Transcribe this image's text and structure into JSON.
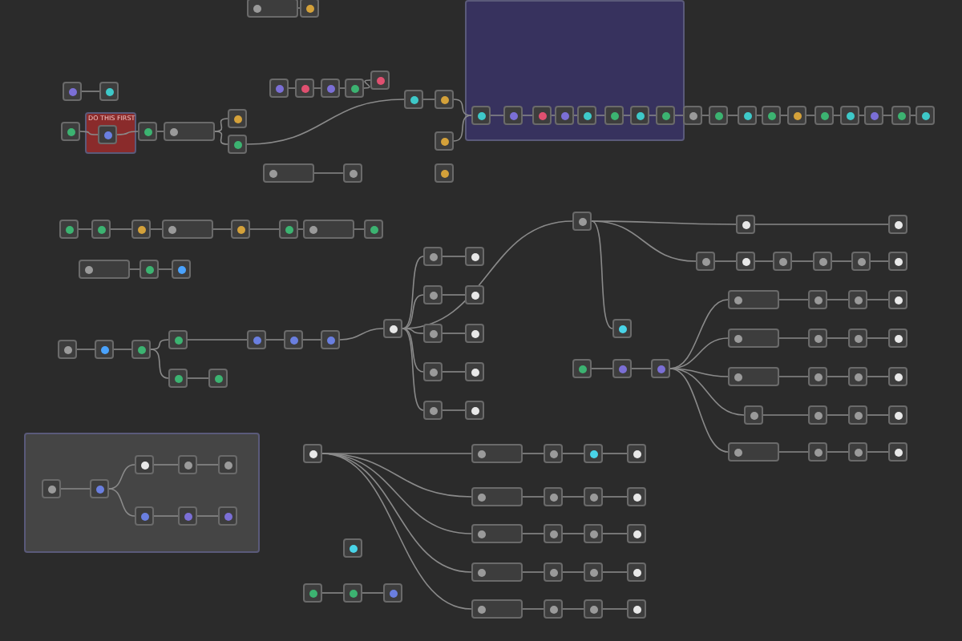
{
  "canvas": {
    "sticky_notes": [
      {
        "color": "#37325e"
      },
      {
        "color": "#8a2b2b",
        "title": "DO THIS FIRST"
      },
      {
        "color": "#454545"
      }
    ],
    "nodes": [
      {
        "kind": "wide",
        "color": "#9a9a9a"
      },
      {
        "kind": "square",
        "color": "#d4a13a"
      },
      {
        "kind": "square",
        "color": "#7b6fd6"
      },
      {
        "kind": "square",
        "color": "#e05070"
      },
      {
        "kind": "square",
        "color": "#7b6fd6"
      },
      {
        "kind": "square",
        "color": "#3cb371"
      },
      {
        "kind": "square",
        "color": "#e05070"
      },
      {
        "kind": "square",
        "color": "#3ec9c9"
      },
      {
        "kind": "square",
        "color": "#d4a13a"
      },
      {
        "kind": "square",
        "color": "#d4a13a"
      },
      {
        "kind": "square",
        "color": "#3ec9c9"
      },
      {
        "kind": "square",
        "color": "#7b6fd6"
      },
      {
        "kind": "square",
        "color": "#e05070"
      },
      {
        "kind": "square",
        "color": "#7b6fd6"
      },
      {
        "kind": "square",
        "color": "#3ec9c9"
      },
      {
        "kind": "square",
        "color": "#3cb371"
      },
      {
        "kind": "square",
        "color": "#3ec9c9"
      },
      {
        "kind": "square",
        "color": "#3cb371"
      },
      {
        "kind": "square",
        "color": "#9a9a9a"
      },
      {
        "kind": "square",
        "color": "#3cb371"
      },
      {
        "kind": "square",
        "color": "#3ec9c9"
      },
      {
        "kind": "square",
        "color": "#3cb371"
      },
      {
        "kind": "square",
        "color": "#d4a13a"
      },
      {
        "kind": "square",
        "color": "#3cb371"
      },
      {
        "kind": "square",
        "color": "#3ec9c9"
      },
      {
        "kind": "square",
        "color": "#7b6fd6"
      },
      {
        "kind": "square",
        "color": "#3cb371"
      },
      {
        "kind": "square",
        "color": "#3ec9c9"
      },
      {
        "kind": "square",
        "color": "#7b6fd6"
      },
      {
        "kind": "square",
        "color": "#3ec9c9"
      },
      {
        "kind": "square",
        "color": "#3cb371"
      },
      {
        "kind": "square",
        "color": "#6a7fe0"
      },
      {
        "kind": "square",
        "color": "#3cb371"
      },
      {
        "kind": "wide",
        "color": "#9a9a9a"
      },
      {
        "kind": "square",
        "color": "#d4a13a"
      },
      {
        "kind": "square",
        "color": "#3cb371"
      },
      {
        "kind": "wide",
        "color": "#9a9a9a"
      },
      {
        "kind": "square",
        "color": "#9a9a9a"
      },
      {
        "kind": "square",
        "color": "#d4a13a"
      },
      {
        "kind": "square",
        "color": "#3cb371"
      },
      {
        "kind": "square",
        "color": "#3cb371"
      },
      {
        "kind": "square",
        "color": "#d4a13a"
      },
      {
        "kind": "wide",
        "color": "#9a9a9a"
      },
      {
        "kind": "square",
        "color": "#d4a13a"
      },
      {
        "kind": "square",
        "color": "#3cb371"
      },
      {
        "kind": "wide",
        "color": "#9a9a9a"
      },
      {
        "kind": "square",
        "color": "#3cb371"
      },
      {
        "kind": "wide",
        "color": "#9a9a9a"
      },
      {
        "kind": "square",
        "color": "#3cb371"
      },
      {
        "kind": "square",
        "color": "#4aa3ff"
      },
      {
        "kind": "square",
        "color": "#9a9a9a"
      },
      {
        "kind": "square",
        "color": "#4aa3ff"
      },
      {
        "kind": "square",
        "color": "#3cb371"
      },
      {
        "kind": "square",
        "color": "#3cb371"
      },
      {
        "kind": "square",
        "color": "#3cb371"
      },
      {
        "kind": "square",
        "color": "#3cb371"
      },
      {
        "kind": "square",
        "color": "#6a7fe0"
      },
      {
        "kind": "square",
        "color": "#6a7fe0"
      },
      {
        "kind": "square",
        "color": "#6a7fe0"
      },
      {
        "kind": "square",
        "color": "#e8e8e8"
      },
      {
        "kind": "square",
        "color": "#9a9a9a"
      },
      {
        "kind": "square",
        "color": "#9a9a9a"
      },
      {
        "kind": "square",
        "color": "#9a9a9a"
      },
      {
        "kind": "square",
        "color": "#9a9a9a"
      },
      {
        "kind": "square",
        "color": "#9a9a9a"
      },
      {
        "kind": "square",
        "color": "#e8e8e8"
      },
      {
        "kind": "square",
        "color": "#e8e8e8"
      },
      {
        "kind": "square",
        "color": "#e8e8e8"
      },
      {
        "kind": "square",
        "color": "#e8e8e8"
      },
      {
        "kind": "square",
        "color": "#e8e8e8"
      },
      {
        "kind": "square",
        "color": "#9a9a9a"
      },
      {
        "kind": "square",
        "color": "#49d4e8"
      },
      {
        "kind": "square",
        "color": "#3cb371"
      },
      {
        "kind": "square",
        "color": "#7b6fd6"
      },
      {
        "kind": "square",
        "color": "#7b6fd6"
      },
      {
        "kind": "square",
        "color": "#e8e8e8"
      },
      {
        "kind": "square",
        "color": "#e8e8e8"
      },
      {
        "kind": "square",
        "color": "#9a9a9a"
      },
      {
        "kind": "square",
        "color": "#e8e8e8"
      },
      {
        "kind": "square",
        "color": "#9a9a9a"
      },
      {
        "kind": "square",
        "color": "#9a9a9a"
      },
      {
        "kind": "square",
        "color": "#9a9a9a"
      },
      {
        "kind": "square",
        "color": "#e8e8e8"
      },
      {
        "kind": "wide",
        "color": "#9a9a9a"
      },
      {
        "kind": "square",
        "color": "#9a9a9a"
      },
      {
        "kind": "square",
        "color": "#9a9a9a"
      },
      {
        "kind": "square",
        "color": "#e8e8e8"
      },
      {
        "kind": "wide",
        "color": "#9a9a9a"
      },
      {
        "kind": "square",
        "color": "#9a9a9a"
      },
      {
        "kind": "square",
        "color": "#9a9a9a"
      },
      {
        "kind": "square",
        "color": "#e8e8e8"
      },
      {
        "kind": "wide",
        "color": "#9a9a9a"
      },
      {
        "kind": "square",
        "color": "#9a9a9a"
      },
      {
        "kind": "square",
        "color": "#9a9a9a"
      },
      {
        "kind": "square",
        "color": "#e8e8e8"
      },
      {
        "kind": "square",
        "color": "#9a9a9a"
      },
      {
        "kind": "square",
        "color": "#9a9a9a"
      },
      {
        "kind": "square",
        "color": "#9a9a9a"
      },
      {
        "kind": "square",
        "color": "#e8e8e8"
      },
      {
        "kind": "wide",
        "color": "#9a9a9a"
      },
      {
        "kind": "square",
        "color": "#9a9a9a"
      },
      {
        "kind": "square",
        "color": "#9a9a9a"
      },
      {
        "kind": "square",
        "color": "#e8e8e8"
      },
      {
        "kind": "square",
        "color": "#e8e8e8"
      },
      {
        "kind": "wide",
        "color": "#9a9a9a"
      },
      {
        "kind": "square",
        "color": "#9a9a9a"
      },
      {
        "kind": "square",
        "color": "#49d4e8"
      },
      {
        "kind": "square",
        "color": "#e8e8e8"
      },
      {
        "kind": "wide",
        "color": "#9a9a9a"
      },
      {
        "kind": "square",
        "color": "#9a9a9a"
      },
      {
        "kind": "square",
        "color": "#9a9a9a"
      },
      {
        "kind": "square",
        "color": "#e8e8e8"
      },
      {
        "kind": "wide",
        "color": "#9a9a9a"
      },
      {
        "kind": "square",
        "color": "#9a9a9a"
      },
      {
        "kind": "square",
        "color": "#9a9a9a"
      },
      {
        "kind": "square",
        "color": "#e8e8e8"
      },
      {
        "kind": "wide",
        "color": "#9a9a9a"
      },
      {
        "kind": "square",
        "color": "#9a9a9a"
      },
      {
        "kind": "square",
        "color": "#9a9a9a"
      },
      {
        "kind": "square",
        "color": "#e8e8e8"
      },
      {
        "kind": "wide",
        "color": "#9a9a9a"
      },
      {
        "kind": "square",
        "color": "#9a9a9a"
      },
      {
        "kind": "square",
        "color": "#9a9a9a"
      },
      {
        "kind": "square",
        "color": "#e8e8e8"
      },
      {
        "kind": "square",
        "color": "#49d4e8"
      },
      {
        "kind": "square",
        "color": "#3cb371"
      },
      {
        "kind": "square",
        "color": "#3cb371"
      },
      {
        "kind": "square",
        "color": "#6a7fe0"
      },
      {
        "kind": "square",
        "color": "#9a9a9a"
      },
      {
        "kind": "square",
        "color": "#6a7fe0"
      },
      {
        "kind": "square",
        "color": "#e8e8e8"
      },
      {
        "kind": "square",
        "color": "#9a9a9a"
      },
      {
        "kind": "square",
        "color": "#9a9a9a"
      },
      {
        "kind": "square",
        "color": "#6a7fe0"
      },
      {
        "kind": "square",
        "color": "#7b6fd6"
      },
      {
        "kind": "square",
        "color": "#7b6fd6"
      }
    ]
  }
}
